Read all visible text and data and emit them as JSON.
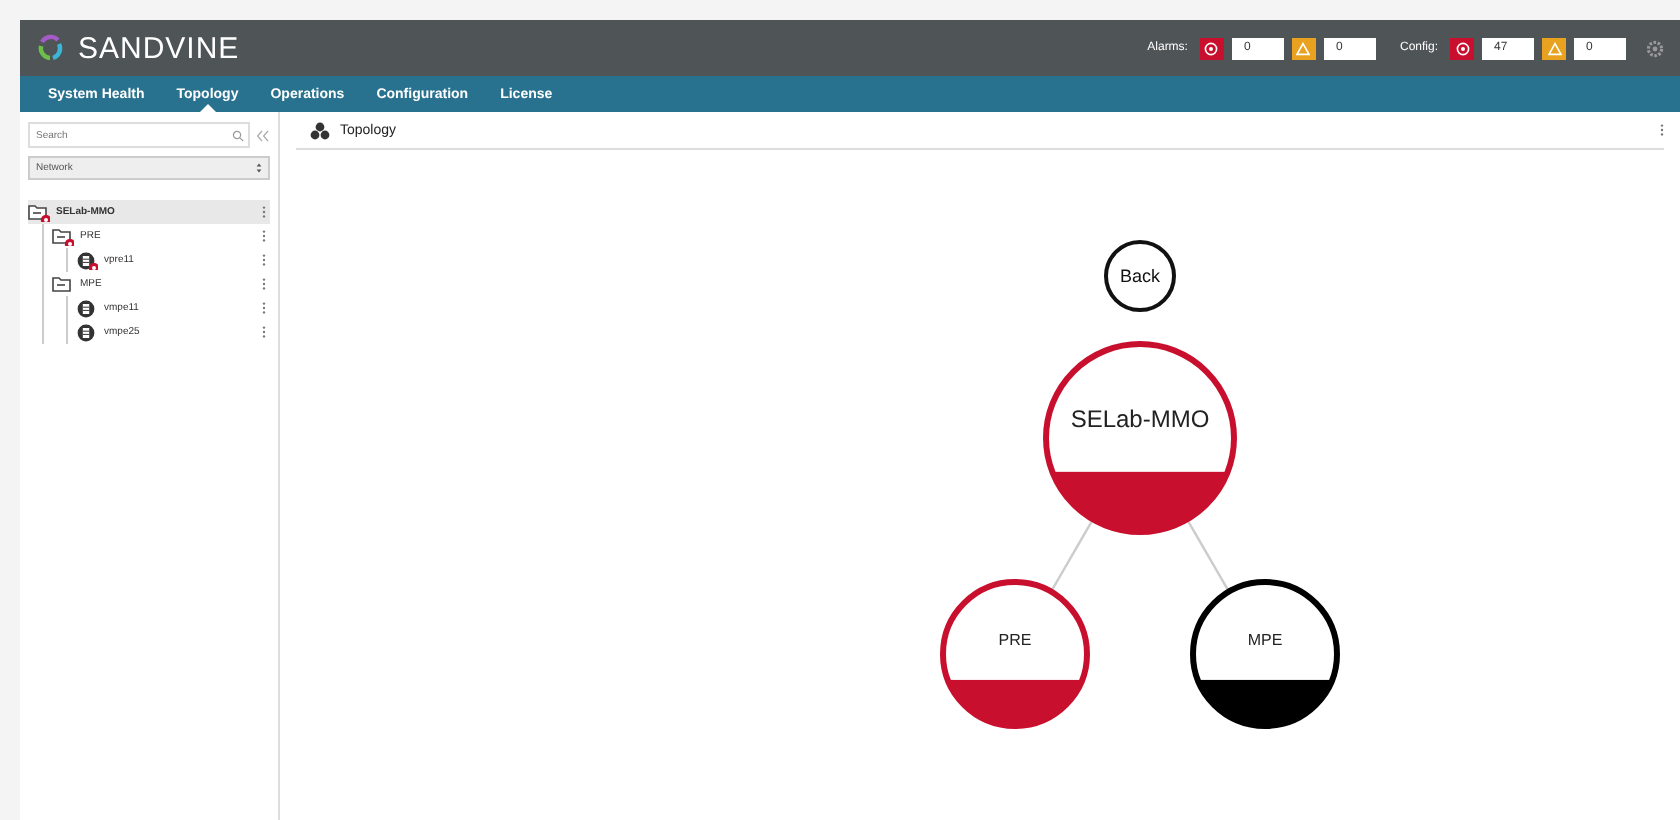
{
  "header": {
    "brand": "SANDVINE",
    "alarms": {
      "label": "Alarms:",
      "critical": "0",
      "warning": "0"
    },
    "config": {
      "label": "Config:",
      "critical": "47",
      "warning": "0"
    }
  },
  "tabs": [
    {
      "label": "System Health",
      "selected": false
    },
    {
      "label": "Topology",
      "selected": true
    },
    {
      "label": "Operations",
      "selected": false
    },
    {
      "label": "Configuration",
      "selected": false
    },
    {
      "label": "License",
      "selected": false
    }
  ],
  "sidebar": {
    "search": {
      "placeholder": "Search"
    },
    "scope": "Network",
    "tree": [
      {
        "label": "SELab-MMO",
        "kind": "folder",
        "alarm": true,
        "selected": true,
        "children": [
          {
            "label": "PRE",
            "kind": "folder",
            "alarm": true,
            "selected": false,
            "children": [
              {
                "label": "vpre11",
                "kind": "device",
                "alarm": true,
                "selected": false
              }
            ]
          },
          {
            "label": "MPE",
            "kind": "folder",
            "alarm": false,
            "selected": false,
            "children": [
              {
                "label": "vmpe11",
                "kind": "device",
                "alarm": false,
                "selected": false
              },
              {
                "label": "vmpe25",
                "kind": "device",
                "alarm": false,
                "selected": false
              }
            ]
          }
        ]
      }
    ]
  },
  "panel": {
    "title": "Topology"
  },
  "topology": {
    "back": "Back",
    "root": {
      "label": "SELab-MMO",
      "color": "#c8102e",
      "children": [
        {
          "label": "PRE",
          "color": "#c8102e"
        },
        {
          "label": "MPE",
          "color": "#000000"
        }
      ]
    }
  }
}
